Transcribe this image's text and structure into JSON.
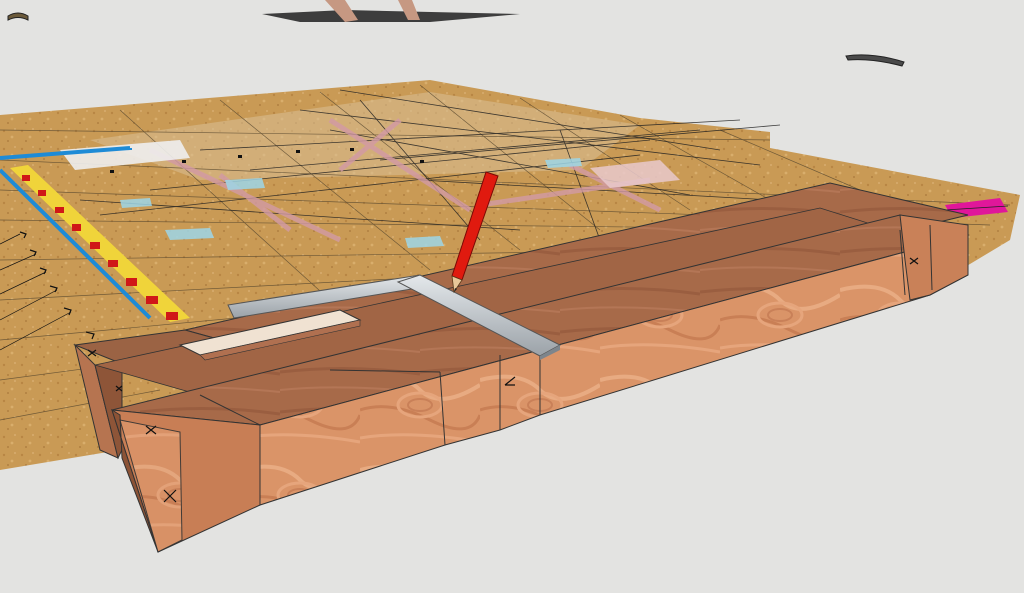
{
  "scene": {
    "kind": "3d-model-viewport",
    "background_color": "#e3e3e1",
    "colors": {
      "plywood": "#c99a55",
      "timber_face": "#d98f60",
      "timber_top": "#a86a48",
      "timber_dark": "#8a5238",
      "blue_line": "#1e8bd6",
      "yellow_band": "#f0d43a",
      "red_marker": "#d01818",
      "pencil_red": "#e01a0f",
      "square_steel": "#b8bec4",
      "magenta_patch": "#e0179a",
      "pink_lines": "#d29aa6",
      "cyan_patch": "#9ed6e8"
    },
    "objects": [
      "layout-floor-sheet",
      "timber-beam-assembly",
      "framing-square",
      "carpenter-pencil",
      "distant-figure-feet",
      "small-tool-left",
      "small-tool-right"
    ]
  }
}
